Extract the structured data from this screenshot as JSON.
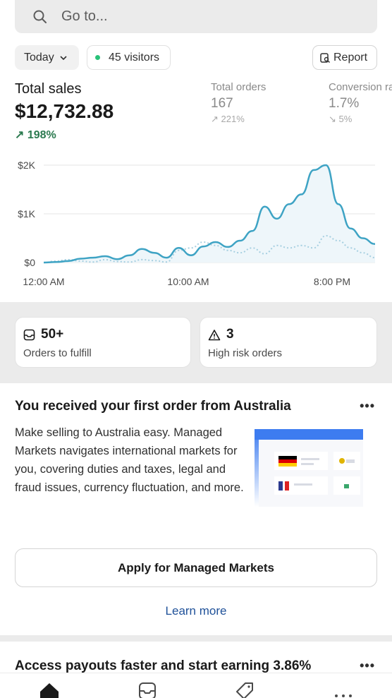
{
  "search": {
    "placeholder": "Go to...",
    "icon": "search-icon"
  },
  "filters": {
    "date_range": "Today",
    "visitors": "45 visitors",
    "report_label": "Report",
    "live_color": "#29c279"
  },
  "metrics": {
    "total_sales": {
      "label": "Total sales",
      "value": "$12,732.88",
      "delta": "198%",
      "delta_color": "#2b7a4f"
    },
    "total_orders": {
      "label": "Total orders",
      "value": "167",
      "delta": "221%"
    },
    "conversion": {
      "label": "Conversion rate",
      "value": "1.7%",
      "delta": "5%"
    }
  },
  "chart_data": {
    "type": "line",
    "xlabel": "",
    "ylabel": "",
    "x_tick_labels": [
      "12:00 AM",
      "10:00 AM",
      "8:00 PM"
    ],
    "y_tick_labels": [
      "$0",
      "$1K",
      "$2K"
    ],
    "ylim": [
      0,
      2000
    ],
    "grid": true,
    "series": [
      {
        "style": "solid",
        "color": "#3ea3c4",
        "values": [
          0,
          10,
          30,
          80,
          100,
          130,
          70,
          150,
          280,
          200,
          100,
          300,
          150,
          330,
          420,
          320,
          450,
          650,
          1150,
          900,
          1200,
          1400,
          1900,
          2000,
          1200,
          700,
          500,
          380
        ]
      },
      {
        "style": "dotted",
        "color": "#a6cfe0",
        "values": [
          0,
          30,
          60,
          30,
          10,
          60,
          20,
          10,
          60,
          40,
          10,
          250,
          300,
          420,
          350,
          250,
          200,
          300,
          180,
          350,
          300,
          350,
          300,
          550,
          450,
          300,
          200,
          100
        ]
      }
    ]
  },
  "tasks": [
    {
      "count": "50+",
      "label": "Orders to fulfill",
      "icon": "order-box-icon"
    },
    {
      "count": "3",
      "label": "High risk orders",
      "icon": "warning-icon"
    }
  ],
  "promo": {
    "title": "You received your first order from Australia",
    "body": "Make selling to Australia easy. Managed Markets navigates international markets for you, covering duties and taxes, legal and fraud issues, currency fluctuation, and more.",
    "primary_action": "Apply for Managed Markets",
    "secondary_action": "Learn more",
    "menu": "•••"
  },
  "promo2": {
    "title": "Access payouts faster and start earning 3.86%",
    "menu": "•••"
  },
  "tabbar": {
    "items": [
      "home-icon",
      "orders-icon",
      "products-icon",
      "more-icon"
    ]
  }
}
